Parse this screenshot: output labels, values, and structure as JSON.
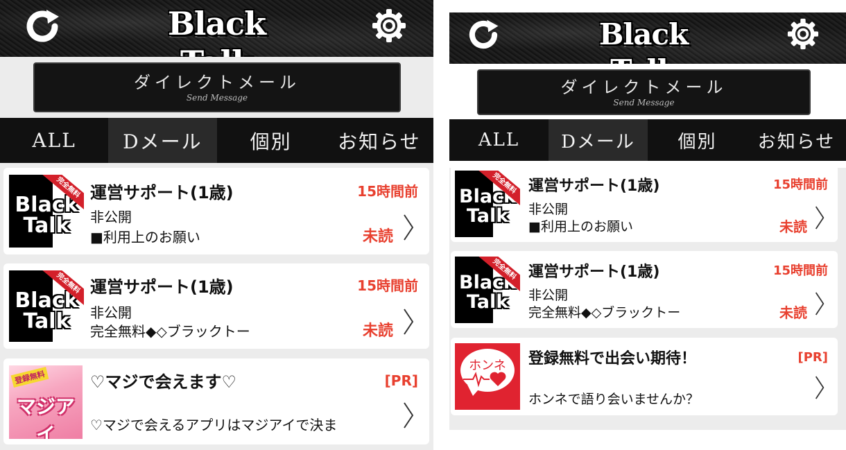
{
  "app": {
    "logo_text": "Black Talk",
    "icons": {
      "refresh": "refresh-icon",
      "settings": "gear-icon",
      "chevron": "chevron-right-icon"
    },
    "colors": {
      "accent_red": "#e8402f",
      "header_bg": "#141414",
      "tab_bg": "#111111"
    }
  },
  "dm_button": {
    "title": "ダイレクトメール",
    "subtitle": "Send Message"
  },
  "tabs": [
    {
      "label": "ALL"
    },
    {
      "label": "Dメール"
    },
    {
      "label": "個別"
    },
    {
      "label": "お知らせ"
    }
  ],
  "left_list": [
    {
      "thumb_text_1": "Black",
      "thumb_text_2": "Talk",
      "ribbon": "完全無料",
      "title": "運営サポート(1歳)",
      "line1": "非公開",
      "line2": "■利用上のお願い",
      "time": "15時間前",
      "status": "未読"
    },
    {
      "thumb_text_1": "Black",
      "thumb_text_2": "Talk",
      "ribbon": "完全無料",
      "title": "運営サポート(1歳)",
      "line1": "非公開",
      "line2": "完全無料◆◇ブラックトー",
      "time": "15時間前",
      "status": "未読"
    },
    {
      "thumb_badge": "登録無料",
      "thumb_name": "マジアイ",
      "title": "♡マジで会えます♡",
      "line2": "♡マジで会えるアプリはマジアイで決ま",
      "time": "[PR]"
    }
  ],
  "right_list": [
    {
      "thumb_text_1": "Black",
      "thumb_text_2": "Talk",
      "ribbon": "完全無料",
      "title": "運営サポート(1歳)",
      "line1": "非公開",
      "line2": "■利用上のお願い",
      "time": "15時間前",
      "status": "未読"
    },
    {
      "thumb_text_1": "Black",
      "thumb_text_2": "Talk",
      "ribbon": "完全無料",
      "title": "運営サポート(1歳)",
      "line1": "非公開",
      "line2": "完全無料◆◇ブラックトー",
      "time": "15時間前",
      "status": "未読"
    },
    {
      "thumb_label": "ホンネ",
      "title": "登録無料で出会い期待！",
      "line2": "ホンネで語り会いませんか？",
      "time": "[PR]"
    }
  ]
}
